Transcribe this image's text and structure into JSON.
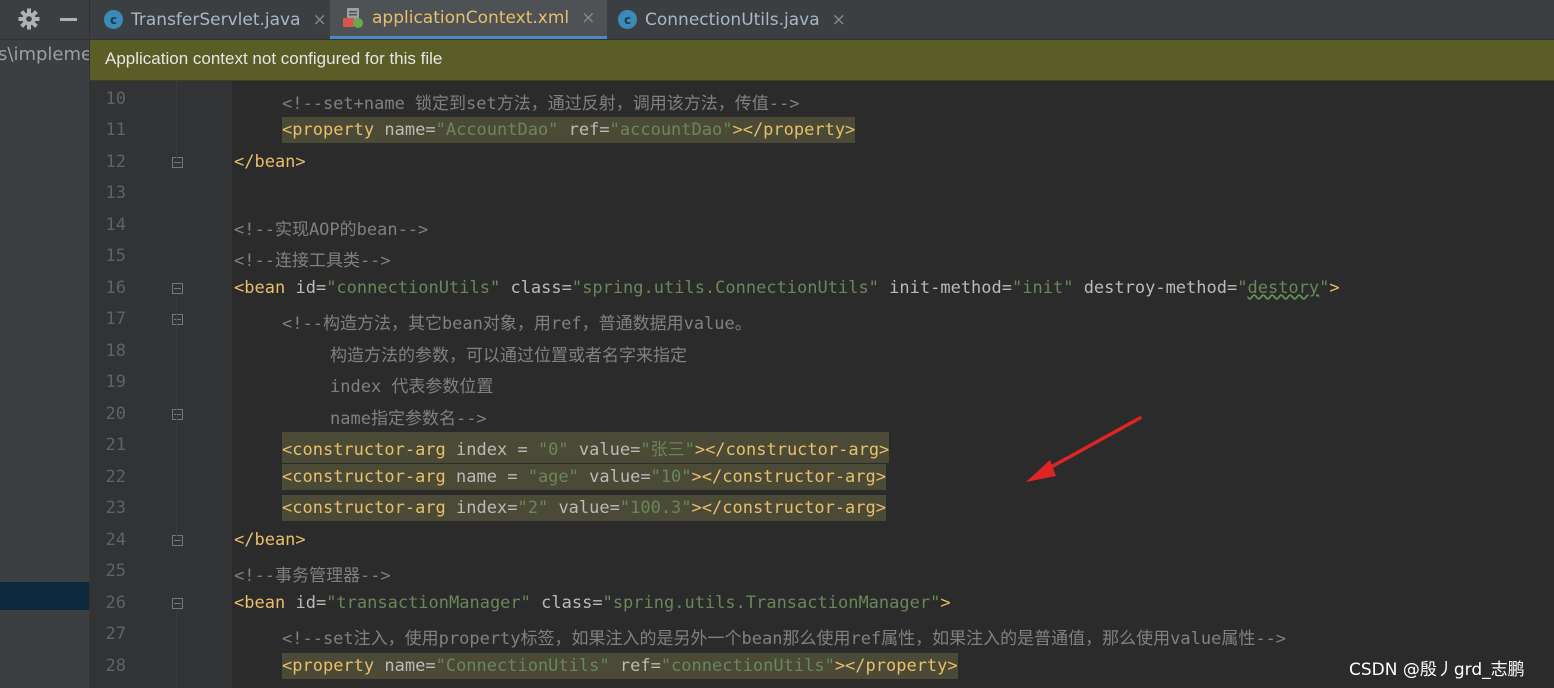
{
  "tabs": [
    {
      "label": "TransferServlet.java",
      "icon": "java-class-icon",
      "icon_letter": "c",
      "close": "×"
    },
    {
      "label": "applicationContext.xml",
      "icon": "xml-file-icon",
      "close": "×"
    },
    {
      "label": "ConnectionUtils.java",
      "icon": "java-class-icon",
      "icon_letter": "c",
      "close": "×"
    }
  ],
  "sidebar": {
    "path_fragment": "s\\impleme"
  },
  "banner": {
    "text": "Application context not configured for this file"
  },
  "gutter": {
    "line_numbers": [
      "10",
      "11",
      "12",
      "13",
      "14",
      "15",
      "16",
      "17",
      "18",
      "19",
      "20",
      "21",
      "22",
      "23",
      "24",
      "25",
      "26",
      "27",
      "28"
    ]
  },
  "code": {
    "l10": {
      "c": "<!--set+name 锁定到set方法，通过反射，调用该方法，传值-->"
    },
    "l11": {
      "lt": "<",
      "tag": "property",
      "sp1": " ",
      "a1": "name",
      "eq1": "=",
      "v1": "\"AccountDao\"",
      "sp2": " ",
      "a2": "ref",
      "eq2": "=",
      "v2": "\"accountDao\"",
      "close": "></property>"
    },
    "l12": {
      "t": "</bean>"
    },
    "l14": {
      "c": "<!--实现AOP的bean-->"
    },
    "l15": {
      "c": "<!--连接工具类-->"
    },
    "l16": {
      "lt": "<",
      "tag": "bean",
      "a1": "id",
      "eq1": "=",
      "v1": "\"connectionUtils\"",
      "a2": "class",
      "eq2": "=",
      "v2": "\"spring.utils.ConnectionUtils\"",
      "a3": "init-method",
      "eq3": "=",
      "v3": "\"init\"",
      "a4": "destroy-method",
      "eq4": "=",
      "v4a": "\"",
      "v4b": "destory",
      "v4c": "\"",
      "close": ">"
    },
    "l17": {
      "c": "<!--构造方法，其它bean对象，用ref，普通数据用value。"
    },
    "l18": {
      "c": "构造方法的参数，可以通过位置或者名字来指定"
    },
    "l19": {
      "c": "index 代表参数位置"
    },
    "l20": {
      "c": "name指定参数名-->"
    },
    "l21": {
      "lt": "<",
      "tag": "constructor-arg",
      "a1": "index",
      "eq1": " = ",
      "v1": "\"0\"",
      "a2": "value",
      "eq2": "=",
      "v2": "\"张三\"",
      "close": "></constructor-arg>"
    },
    "l22": {
      "lt": "<",
      "tag": "constructor-arg",
      "a1": "name",
      "eq1": " = ",
      "v1": "\"age\"",
      "a2": "value",
      "eq2": "=",
      "v2": "\"10\"",
      "close": "></constructor-arg>"
    },
    "l23": {
      "lt": "<",
      "tag": "constructor-arg",
      "a1": "index",
      "eq1": "=",
      "v1": "\"2\"",
      "a2": "value",
      "eq2": "=",
      "v2": "\"100.3\"",
      "close": "></constructor-arg>"
    },
    "l24": {
      "t": "</bean>"
    },
    "l25": {
      "c": "<!--事务管理器-->"
    },
    "l26": {
      "lt": "<",
      "tag": "bean",
      "a1": "id",
      "eq1": "=",
      "v1": "\"transactionManager\"",
      "a2": "class",
      "eq2": "=",
      "v2": "\"spring.utils.TransactionManager\"",
      "close": ">"
    },
    "l27": {
      "c": "<!--set注入，使用property标签，如果注入的是另外一个bean那么使用ref属性，如果注入的是普通值，那么使用value属性-->"
    },
    "l28": {
      "lt": "<",
      "tag": "property",
      "a1": "name",
      "eq1": "=",
      "v1": "\"ConnectionUtils\"",
      "a2": "ref",
      "eq2": "=",
      "v2": "\"connectionUtils\"",
      "close": "></property>"
    }
  },
  "annotation": {
    "arrow_color": "#e02424"
  },
  "watermark": {
    "text": "CSDN @殷丿grd_志鹏"
  },
  "colors": {
    "tag": "#e8bf6a",
    "attr": "#bababa",
    "value": "#6a8759",
    "comment": "#808080",
    "banner": "#5a5d25",
    "highlight": "#4b4a36"
  }
}
